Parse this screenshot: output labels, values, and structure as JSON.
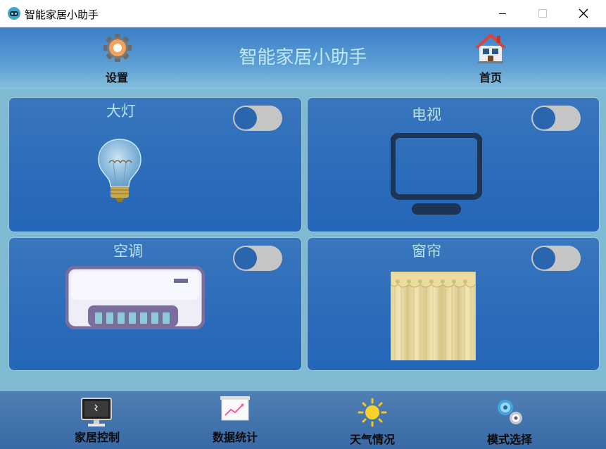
{
  "window": {
    "title": "智能家居小助手"
  },
  "header": {
    "title": "智能家居小助手",
    "settings_label": "设置",
    "home_label": "首页"
  },
  "devices": [
    {
      "name": "大灯",
      "icon": "light-bulb-icon",
      "on": false
    },
    {
      "name": "电视",
      "icon": "tv-icon",
      "on": false
    },
    {
      "name": "空调",
      "icon": "air-conditioner-icon",
      "on": false
    },
    {
      "name": "窗帘",
      "icon": "curtain-icon",
      "on": false
    }
  ],
  "nav": [
    {
      "label": "家居控制",
      "icon": "monitor-icon"
    },
    {
      "label": "数据统计",
      "icon": "chart-board-icon"
    },
    {
      "label": "天气情况",
      "icon": "sun-icon"
    },
    {
      "label": "模式选择",
      "icon": "gears-icon"
    }
  ],
  "colors": {
    "header_gradient_top": "#3a7fc7",
    "card_blue": "#2b6bba",
    "title_cyan": "#bfe8f8",
    "toggle_track": "#c6c6c6",
    "toggle_knob": "#2a66ae"
  }
}
